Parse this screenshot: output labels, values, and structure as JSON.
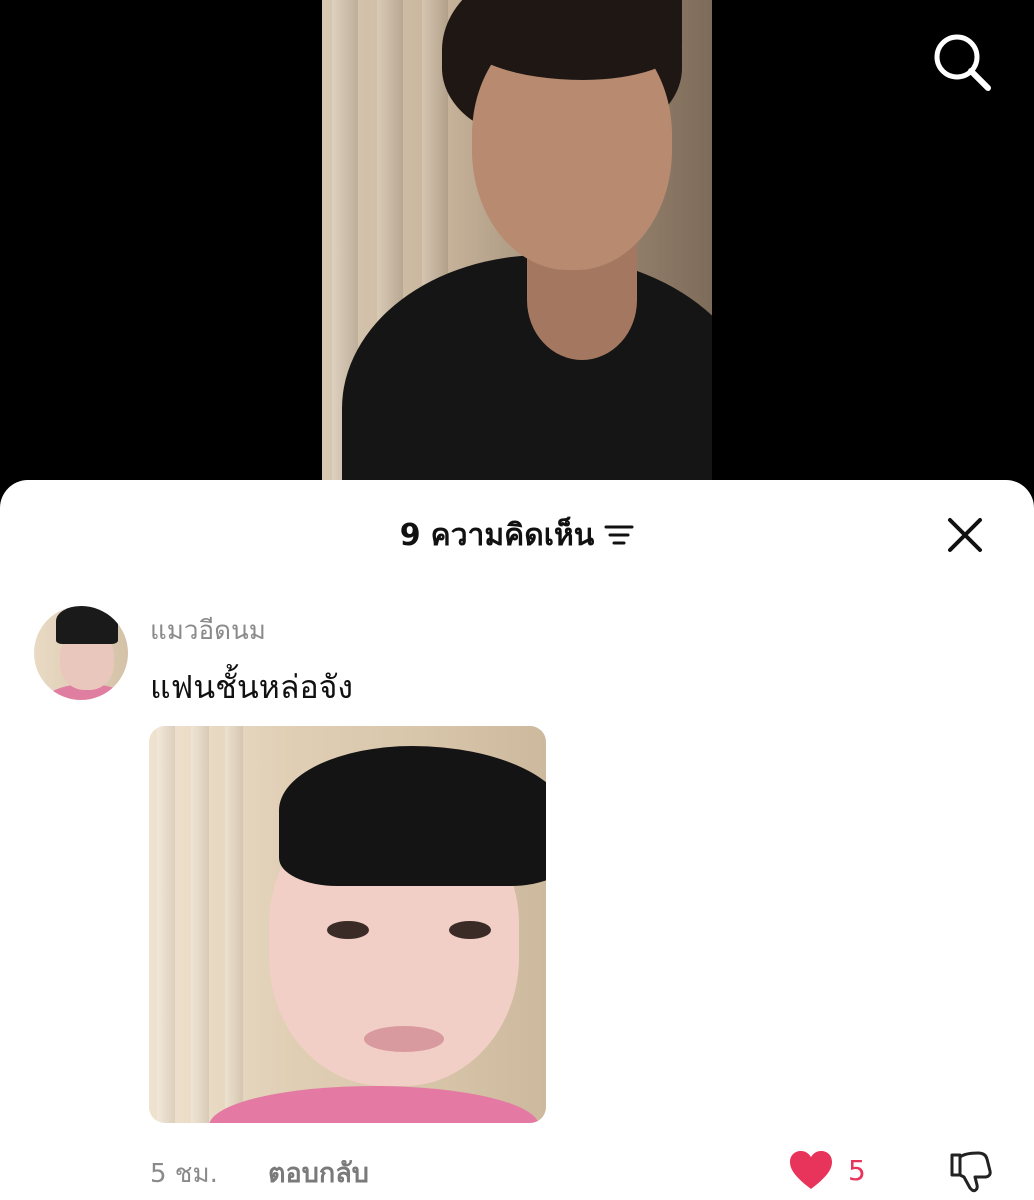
{
  "comments_sheet": {
    "count": "9",
    "title": "ความคิดเห็น"
  },
  "comments": [
    {
      "username": "แมวอีดนม",
      "text": "แฟนชั้นหล่อจัง",
      "time": "5 ชม.",
      "reply_label": "ตอบกลับ",
      "likes": "5"
    }
  ],
  "colors": {
    "like": "#e8335a",
    "sheet_background": "#ffffff",
    "video_background": "#000000"
  },
  "icons": {
    "search": "search-icon",
    "sort": "sort-icon",
    "close": "close-icon",
    "like": "heart-icon",
    "dislike": "dislike-icon"
  }
}
